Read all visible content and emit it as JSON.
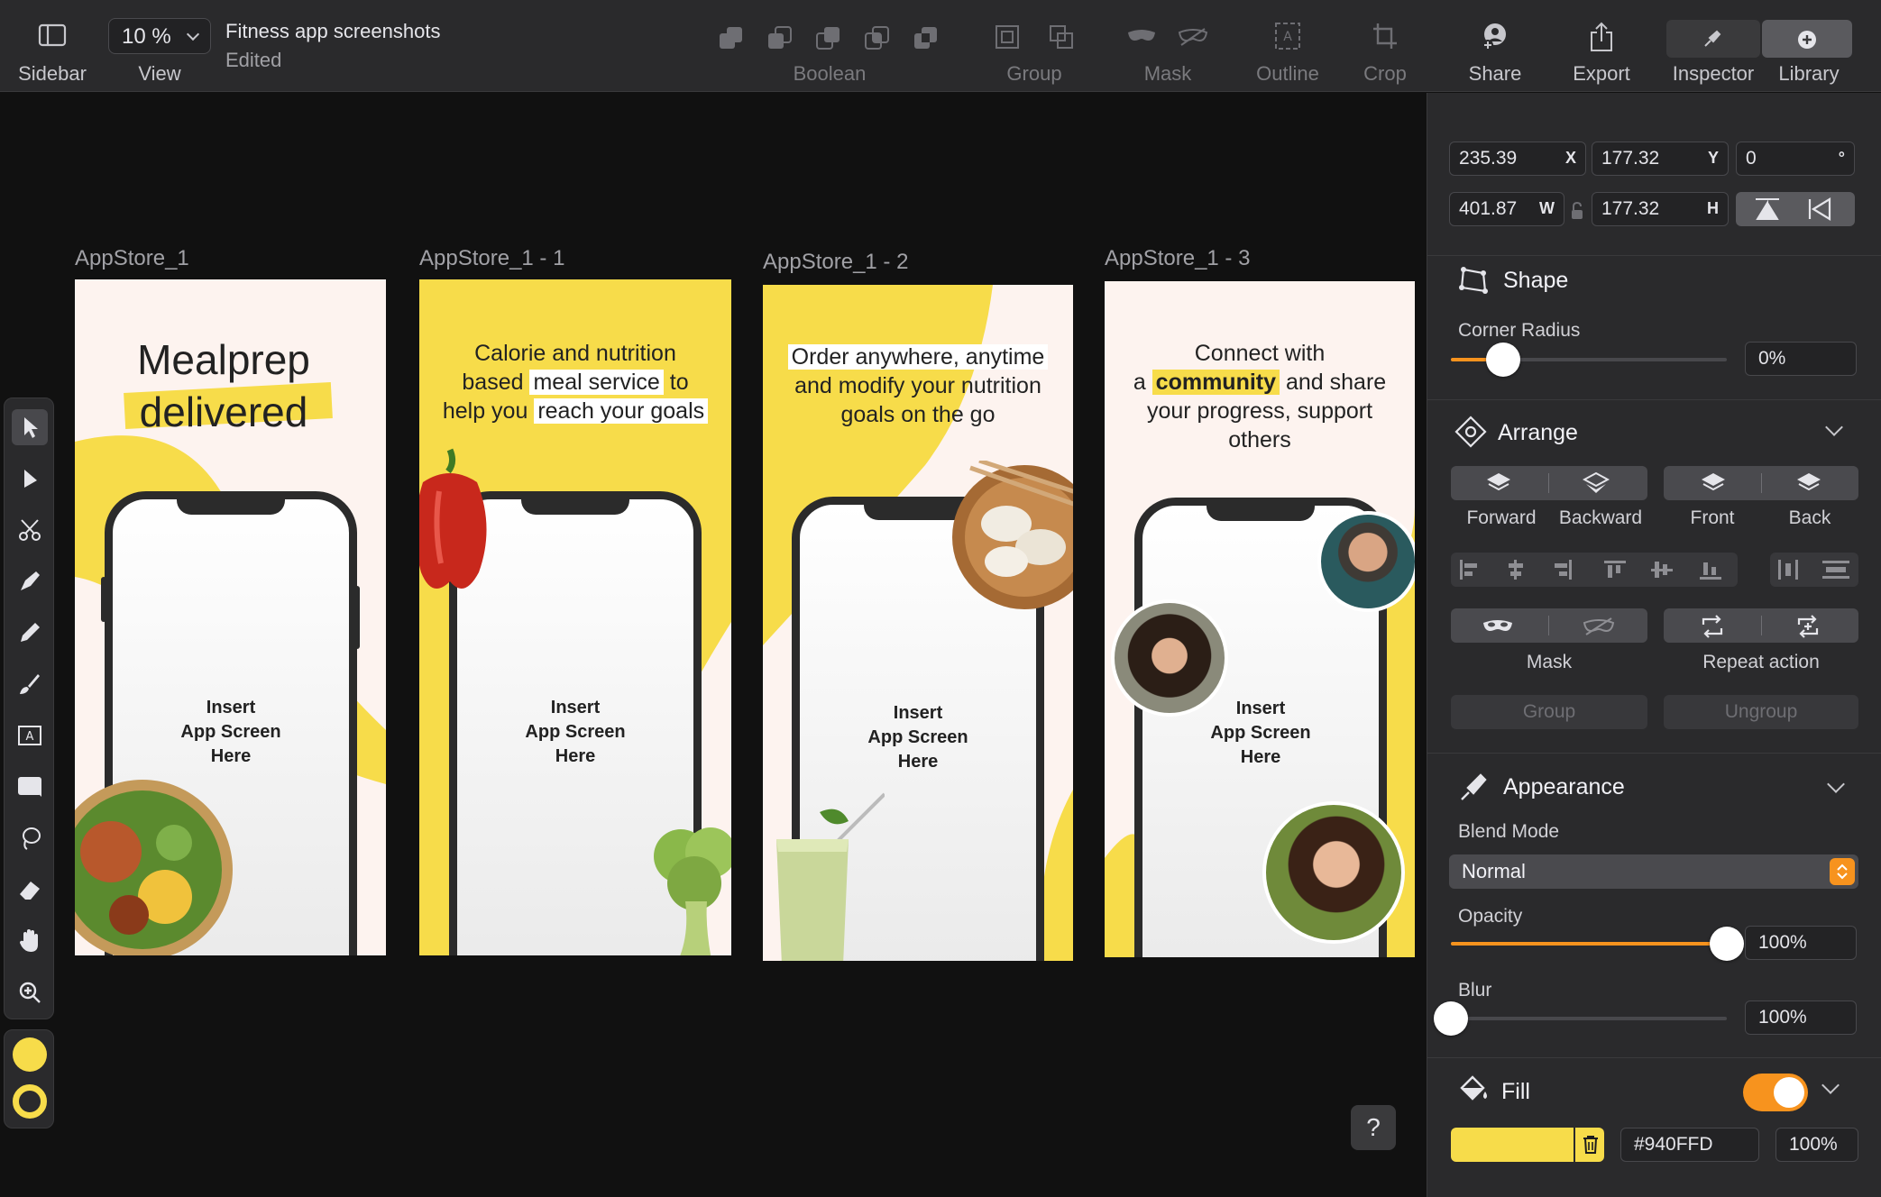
{
  "toolbar": {
    "sidebar_label": "Sidebar",
    "view_label": "View",
    "zoom_value": "10 %",
    "doc_title": "Fitness app screenshots",
    "doc_status": "Edited",
    "boolean_label": "Boolean",
    "group_label": "Group",
    "mask_label": "Mask",
    "outline_label": "Outline",
    "crop_label": "Crop",
    "share_label": "Share",
    "export_label": "Export",
    "inspector_label": "Inspector",
    "library_label": "Library"
  },
  "artboards": [
    {
      "label": "AppStore_1",
      "headline_1": "Mealprep",
      "headline_2": "delivered",
      "insert": "Insert\nApp Screen\nHere"
    },
    {
      "label": "AppStore_1 - 1",
      "line1": "Calorie and nutrition",
      "line2a": "based ",
      "line2b": "meal service",
      "line2c": " to",
      "line3a": "help you ",
      "line3b": "reach your goals",
      "insert": "Insert\nApp Screen\nHere"
    },
    {
      "label": "AppStore_1 - 2",
      "line1": "Order anywhere, anytime",
      "line2": "and modify your nutrition",
      "line3": "goals on the go",
      "insert": "Insert\nApp Screen\nHere"
    },
    {
      "label": "AppStore_1 - 3",
      "line1": "Connect with",
      "line2a": "a ",
      "line2b": "community",
      "line2c": " and share",
      "line3": "your progress, support",
      "line4": "others",
      "insert": "Insert\nApp Screen\nHere"
    }
  ],
  "inspector": {
    "x": "235.39",
    "x_tag": "X",
    "y": "177.32",
    "y_tag": "Y",
    "rotation": "0",
    "rotation_tag": "°",
    "w": "401.87",
    "w_tag": "W",
    "h": "177.32",
    "h_tag": "H",
    "shape_title": "Shape",
    "corner_radius_label": "Corner Radius",
    "corner_radius_value": "0%",
    "corner_radius_level": 0.19,
    "arrange_title": "Arrange",
    "forward": "Forward",
    "backward": "Backward",
    "front": "Front",
    "back": "Back",
    "mask_caption": "Mask",
    "repeat_caption": "Repeat action",
    "group_btn": "Group",
    "ungroup_btn": "Ungroup",
    "appearance_title": "Appearance",
    "blend_mode_label": "Blend Mode",
    "blend_mode_value": "Normal",
    "opacity_label": "Opacity",
    "opacity_value": "100%",
    "opacity_level": 1.0,
    "blur_label": "Blur",
    "blur_value": "100%",
    "blur_level": 0.0,
    "fill_title": "Fill",
    "fill_enabled": true,
    "fill_hex": "#940FFD",
    "fill_opacity": "100%",
    "fill_swatch_color": "#f7dc4a"
  },
  "help_label": "?",
  "colors": {
    "accent": "#f7931e",
    "brand_yellow": "#f7dc4a",
    "cream": "#fdf3ef"
  }
}
